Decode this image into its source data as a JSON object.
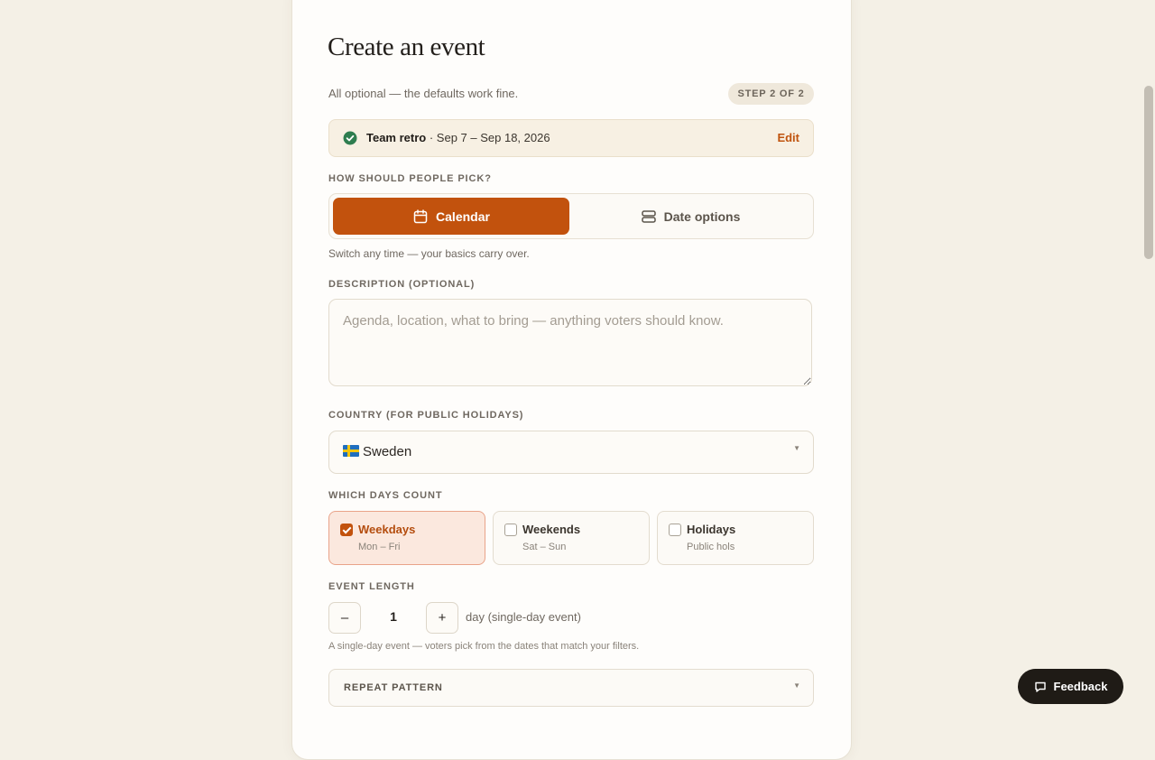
{
  "page": {
    "title": "Create an event",
    "subtitle": "All optional — the defaults work fine.",
    "step_badge": "STEP 2 OF 2"
  },
  "summary": {
    "event_name": "Team retro",
    "separator": " · ",
    "date_range": "Sep 7 – Sep 18, 2026",
    "edit_label": "Edit",
    "icon": "check-circle-icon"
  },
  "pick_mode": {
    "label": "HOW SHOULD PEOPLE PICK?",
    "options": [
      {
        "label": "Calendar",
        "icon": "calendar-icon",
        "selected": true
      },
      {
        "label": "Date options",
        "icon": "list-icon",
        "selected": false
      }
    ],
    "hint": "Switch any time — your basics carry over."
  },
  "description": {
    "label": "DESCRIPTION (OPTIONAL)",
    "value": "",
    "placeholder": "Agenda, location, what to bring — anything voters should know."
  },
  "country": {
    "label": "COUNTRY (FOR PUBLIC HOLIDAYS)",
    "value": "Sweden",
    "flag_icon": "sweden-flag-icon"
  },
  "days": {
    "label": "WHICH DAYS COUNT",
    "options": [
      {
        "title": "Weekdays",
        "subtitle": "Mon – Fri",
        "checked": true
      },
      {
        "title": "Weekends",
        "subtitle": "Sat – Sun",
        "checked": false
      },
      {
        "title": "Holidays",
        "subtitle": "Public hols",
        "checked": false
      }
    ]
  },
  "event_length": {
    "label": "EVENT LENGTH",
    "decrement_label": "–",
    "value": "1",
    "increment_label": "+",
    "unit": "day (single-day event)",
    "hint": "A single-day event — voters pick from the dates that match your filters."
  },
  "repeat": {
    "label": "REPEAT PATTERN"
  },
  "feedback": {
    "label": "Feedback",
    "icon": "chat-icon"
  },
  "colors": {
    "accent": "#c2520d",
    "background": "#f4f0e6",
    "success": "#2e7d4f"
  }
}
